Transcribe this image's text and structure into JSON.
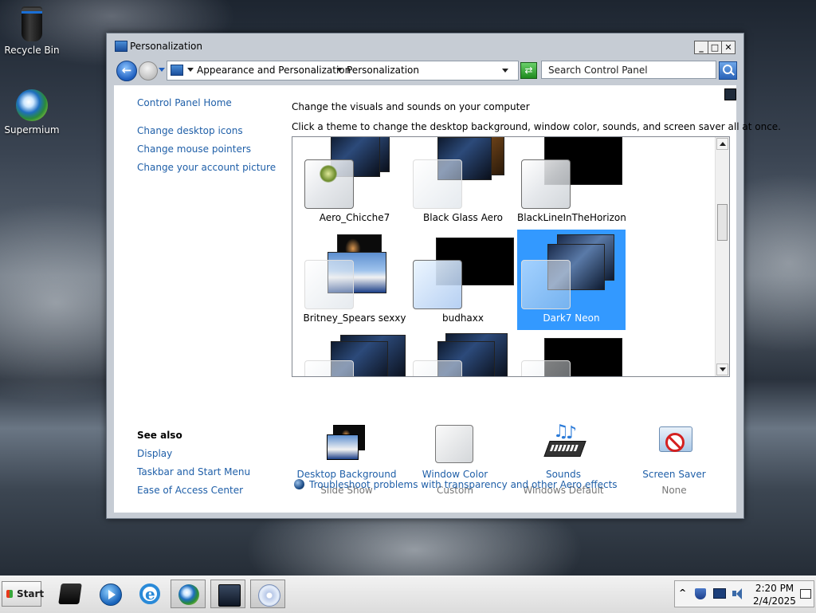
{
  "desktop": {
    "icons": [
      {
        "label": "Recycle Bin",
        "icon": "recycle-bin-icon"
      },
      {
        "label": "Supermium",
        "icon": "supermium-browser-icon"
      }
    ]
  },
  "window": {
    "title": "Personalization",
    "controls": {
      "minimize": "_",
      "maximize": "□",
      "close": "✕"
    },
    "address": {
      "breadcrumbs": [
        "Appearance and Personalization",
        "Personalization"
      ]
    },
    "search": {
      "placeholder": "Search Control Panel"
    }
  },
  "sidebar": {
    "home": "Control Panel Home",
    "links": [
      "Change desktop icons",
      "Change mouse pointers",
      "Change your account picture"
    ],
    "see_also_title": "See also",
    "see_also": [
      "Display",
      "Taskbar and Start Menu",
      "Ease of Access Center"
    ]
  },
  "main": {
    "heading": "Change the visuals and sounds on your computer",
    "subheading": "Click a theme to change the desktop background, window color, sounds, and screen saver all at once.",
    "themes": [
      {
        "name": "Aero_Chicche7",
        "selected": false
      },
      {
        "name": "Black Glass Aero",
        "selected": false
      },
      {
        "name": "BlackLineInTheHorizon",
        "selected": false
      },
      {
        "name": "Britney_Spears sexxy",
        "selected": false
      },
      {
        "name": "budhaxx",
        "selected": false
      },
      {
        "name": "Dark7 Neon",
        "selected": true
      }
    ],
    "settings": [
      {
        "name": "Desktop Background",
        "value": "Slide Show"
      },
      {
        "name": "Window Color",
        "value": "Custom"
      },
      {
        "name": "Sounds",
        "value": "Windows Default"
      },
      {
        "name": "Screen Saver",
        "value": "None"
      }
    ],
    "troubleshoot": "Troubleshoot problems with transparency and other Aero effects"
  },
  "taskbar": {
    "start_label": "Start",
    "clock": {
      "time": "2:20 PM",
      "date": "2/4/2025"
    },
    "tray_chevron": "^"
  },
  "colors": {
    "link": "#1f5fa8",
    "selection": "#3399ff",
    "window_frame": "#c6ccd4"
  }
}
